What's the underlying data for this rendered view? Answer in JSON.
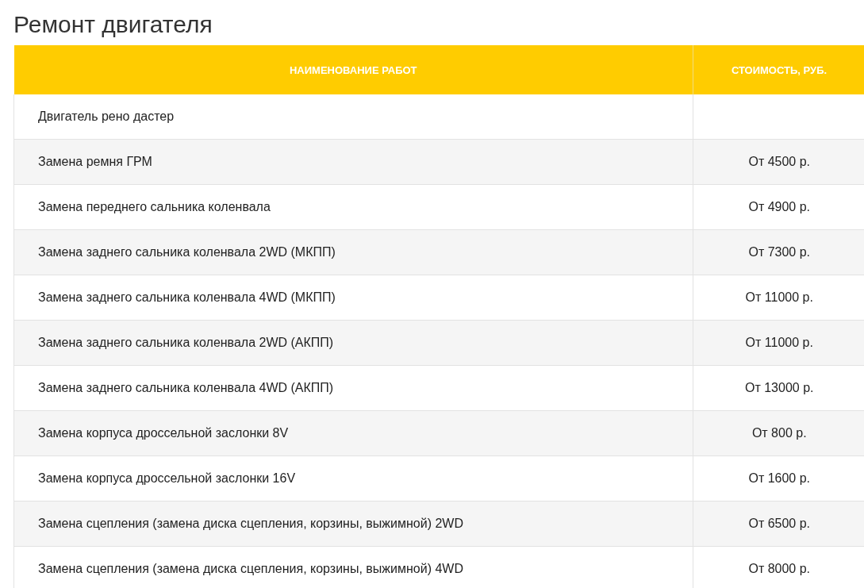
{
  "title": "Ремонт двигателя",
  "table": {
    "columns": [
      "НАИМЕНОВАНИЕ РАБОТ",
      "СТОИМОСТЬ, РУБ."
    ],
    "rows": [
      {
        "name": "Двигатель рено дастер"
      },
      {
        "name": "Замена ремня ГРМ",
        "price": "От 4500 р."
      },
      {
        "name": "Замена переднего сальника коленвала",
        "price": "От 4900 р."
      },
      {
        "name": "Замена заднего сальника коленвала 2WD (МКПП)",
        "price": "От 7300 р."
      },
      {
        "name": "Замена заднего сальника коленвала 4WD (МКПП)",
        "price": "От 11000 р."
      },
      {
        "name": "Замена заднего сальника коленвала 2WD (АКПП)",
        "price": "От 11000 р."
      },
      {
        "name": "Замена заднего сальника коленвала 4WD (АКПП)",
        "price": "От 13000 р."
      },
      {
        "name": "Замена корпуса дроссельной заслонки 8V",
        "price": "От 800 р."
      },
      {
        "name": "Замена корпуса дроссельной заслонки 16V",
        "price": "От 1600 р."
      },
      {
        "name": "Замена сцепления (замена диска сцепления, корзины, выжимной) 2WD",
        "price": "От 6500 р."
      },
      {
        "name": "Замена сцепления (замена диска сцепления, корзины, выжимной) 4WD",
        "price": "От 8000 р."
      }
    ]
  }
}
